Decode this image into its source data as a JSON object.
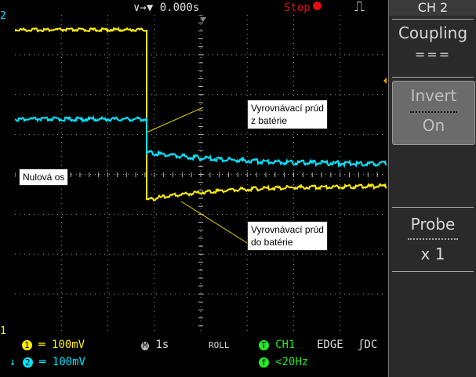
{
  "topbar": {
    "trigger_time": "∨→▼ 0.000s",
    "run_state": "Stop",
    "edge_glyph": "⎍"
  },
  "channel_markers": {
    "ch2": "2",
    "ch1": "1"
  },
  "annotations": {
    "zero_axis": "Nulová os",
    "from_battery_line1": "Vyrovnávací prúd",
    "from_battery_line2": "z batérie",
    "to_battery_line1": "Vyrovnávací prúd",
    "to_battery_line2": "do batérie"
  },
  "side_panel": {
    "title": "CH 2",
    "coupling_label": "Coupling",
    "coupling_value": "===",
    "invert_label": "Invert",
    "invert_value": "On",
    "probe_label": "Probe",
    "probe_value": "x 1"
  },
  "bottombar": {
    "ch1_badge": "1",
    "ch1_scale": "═ 100mV",
    "ch2_prefix": "↓",
    "ch2_badge": "2",
    "ch2_scale": "═ 100mV",
    "timebase_badge": "M",
    "timebase": "1s",
    "mode": "ROLL",
    "trig_badge": "T",
    "trig_source": "CH1",
    "trig_type": "EDGE",
    "trig_coupling": "ʃDC",
    "filter_badge": "f",
    "filter": "<20Hz"
  },
  "colors": {
    "ch1": "#ffee00",
    "ch2": "#00e5ff",
    "grid": "#9a9a9a"
  }
}
